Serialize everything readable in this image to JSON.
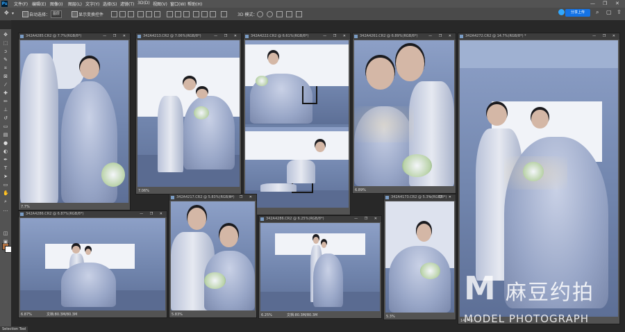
{
  "menu": {
    "items": [
      "文件(F)",
      "编辑(E)",
      "图像(I)",
      "图层(L)",
      "文字(Y)",
      "选择(S)",
      "滤镜(T)",
      "3D(D)",
      "视图(V)",
      "窗口(W)",
      "帮助(H)"
    ]
  },
  "options": {
    "auto_select_label": "自动选择：",
    "auto_select_value": "图层",
    "show_transform_label": "显示变换控件",
    "mode_3d_label": "3D 模式：",
    "share_label": "分享上传"
  },
  "documents": [
    {
      "title": "342A4285.CR2 @ 7.7%(RGB/8*)",
      "zoom": "7.7%"
    },
    {
      "title": "342A4213.CR2 @ 7.06%(RGB/8*)",
      "zoom": "7.06%"
    },
    {
      "title": "342A4222.CR2 @ 6.61%(RGB/8*)",
      "zoom": ""
    },
    {
      "title": "342A4261.CR2 @ 6.89%(RGB/8*)",
      "zoom": "6.89%"
    },
    {
      "title": "342A4272.CR2 @ 14.7%(RGB/8*) *",
      "zoom": "14.74%"
    },
    {
      "title": "342A4286.CR2 @ 6.87%(RGB/8*)",
      "zoom": "6.87%",
      "doc": "文档:80.3M/80.3M"
    },
    {
      "title": "342A4217.CR2 @ 5.83%(RGB/8*)",
      "zoom": "5.83%"
    },
    {
      "title": "342A4286.CR2 @ 6.25%(RGB/8*)",
      "zoom": "6.25%",
      "doc": "文档:80.3M/80.3M"
    },
    {
      "title": "342A4173.CR2 @ 5.3%(RGB/8*)",
      "zoom": "5.3%"
    }
  ],
  "tools": [
    "move-icon",
    "marquee-icon",
    "lasso-icon",
    "quick-select-icon",
    "crop-icon",
    "frame-icon",
    "eyedropper-icon",
    "healing-icon",
    "brush-icon",
    "stamp-icon",
    "history-brush-icon",
    "eraser-icon",
    "gradient-icon",
    "blur-icon",
    "dodge-icon",
    "pen-icon",
    "type-icon",
    "path-select-icon",
    "rectangle-icon",
    "hand-icon",
    "zoom-icon",
    "more-icon"
  ],
  "tooltip": "Selection Tool",
  "watermark": {
    "logo": "M",
    "chinese": "麻豆约拍",
    "english": "MODEL PHOTOGRAPH"
  },
  "colors": {
    "accent": "#1473e6",
    "foreground": "#b07040",
    "background": "#ffffff"
  }
}
